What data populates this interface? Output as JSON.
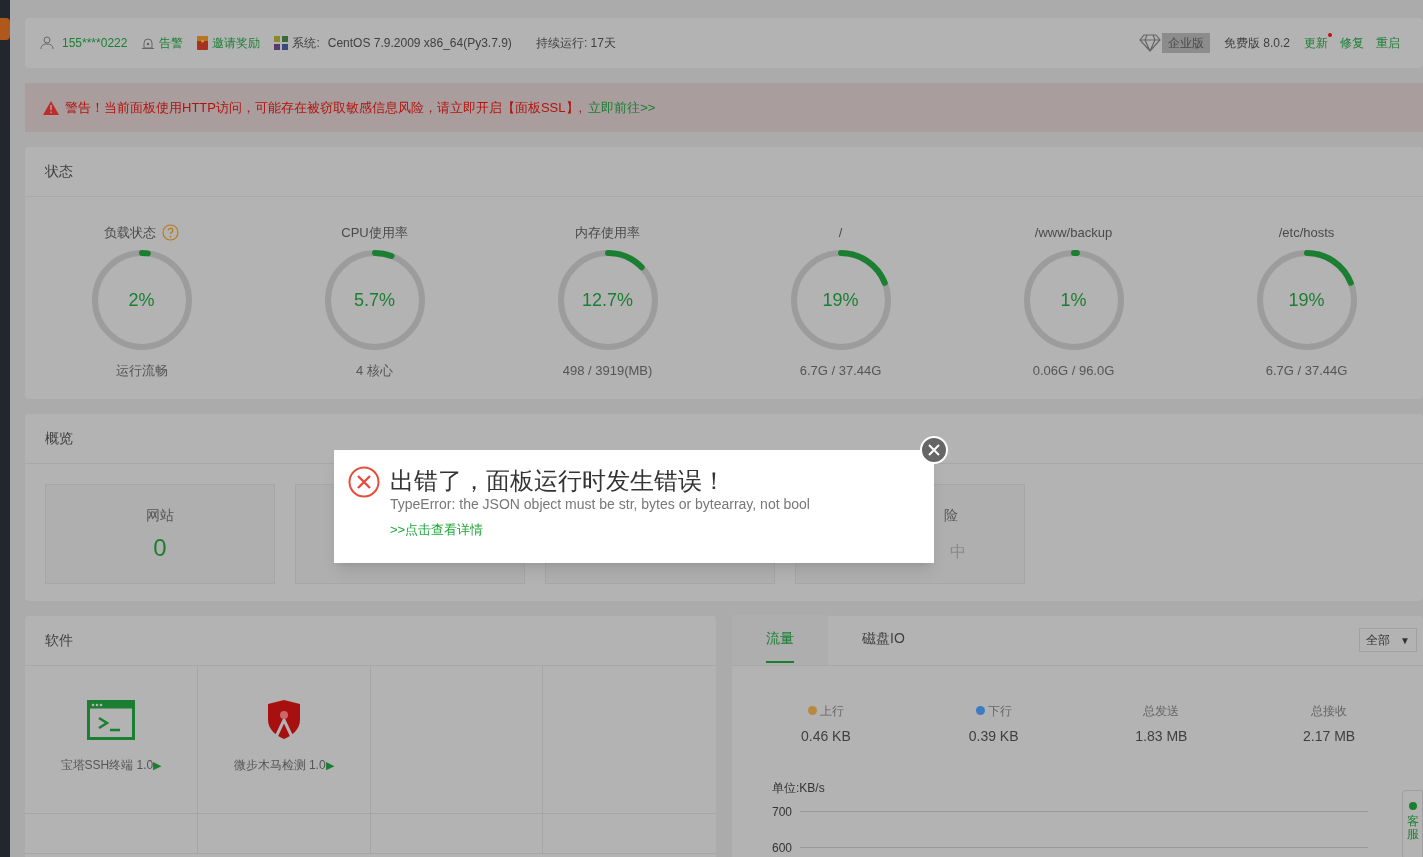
{
  "top_bar": {
    "user": "155****0222",
    "alarm": "告警",
    "invite": "邀请奖励",
    "system_label": "系统:",
    "system_value": "CentOS 7.9.2009 x86_64(Py3.7.9)",
    "uptime": "持续运行: 17天",
    "edition_badge": "企业版",
    "version": "免费版 8.0.2",
    "links": [
      {
        "label": "更新",
        "has_dot": true
      },
      {
        "label": "修复",
        "has_dot": false
      },
      {
        "label": "重启",
        "has_dot": false
      }
    ]
  },
  "alert": {
    "text": "警告！当前面板使用HTTP访问，可能存在被窃取敏感信息风险，请立即开启【面板SSL】,",
    "link": "立即前往>>"
  },
  "status": {
    "title": "状态",
    "gauges": [
      {
        "label": "负载状态",
        "help": true,
        "value": "2%",
        "level": 0.02,
        "caption": "运行流畅"
      },
      {
        "label": "CPU使用率",
        "help": false,
        "value": "5.7%",
        "level": 0.057,
        "caption": "4 核心"
      },
      {
        "label": "内存使用率",
        "help": false,
        "value": "12.7%",
        "level": 0.127,
        "caption": "498 / 3919(MB)"
      },
      {
        "label": "/",
        "help": false,
        "value": "19%",
        "level": 0.19,
        "caption": "6.7G / 37.44G"
      },
      {
        "label": "/www/backup",
        "help": false,
        "value": "1%",
        "level": 0.01,
        "caption": "0.06G / 96.0G"
      },
      {
        "label": "/etc/hosts",
        "help": false,
        "value": "19%",
        "level": 0.19,
        "caption": "6.7G / 37.44G"
      }
    ]
  },
  "overview": {
    "title": "概览",
    "cards": [
      {
        "kind": "full",
        "label": "网站",
        "value": "0"
      },
      {
        "kind": "covered"
      },
      {
        "kind": "covered"
      },
      {
        "kind": "partial",
        "label": "险",
        "value": "中"
      }
    ]
  },
  "software": {
    "title": "软件",
    "items": [
      {
        "kind": "terminal",
        "name": "宝塔SSH终端 1.0",
        "play": "▶"
      },
      {
        "kind": "shield",
        "name": "微步木马检测 1.0",
        "play": "▶"
      }
    ]
  },
  "traffic": {
    "tabs": [
      {
        "label": "流量",
        "selected": true
      },
      {
        "label": "磁盘IO",
        "selected": false
      }
    ],
    "select": {
      "value": "全部",
      "caret": "▼"
    },
    "stats": [
      {
        "label": "上行",
        "value": "0.46 KB",
        "color": "#b8893f"
      },
      {
        "label": "下行",
        "value": "0.39 KB",
        "color": "#3d7cc4"
      },
      {
        "label": "总发送",
        "value": "1.83 MB"
      },
      {
        "label": "总接收",
        "value": "2.17 MB"
      }
    ],
    "unit": "单位:KB/s",
    "yticks": [
      "700",
      "600"
    ]
  },
  "support": "客服",
  "dialog": {
    "title": "出错了，面板运行时发生错误！",
    "message": "TypeError: the JSON object must be str, bytes or bytearray, not bool",
    "link": ">>点击查看详情"
  }
}
